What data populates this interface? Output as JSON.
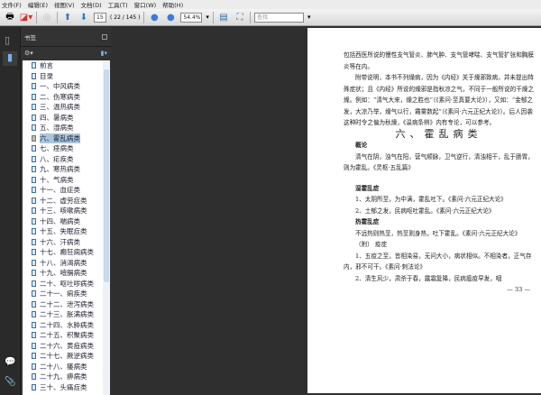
{
  "menu": [
    "文件(F)",
    "编辑(E)",
    "视图(V)",
    "文档(D)",
    "工具(T)",
    "窗口(W)",
    "帮助(H)"
  ],
  "toolbar": {
    "page_number": "15",
    "page_count": "( 22 / 145 )",
    "zoom": "54.4%",
    "search_placeholder": "查找"
  },
  "panel": {
    "title": "书签"
  },
  "bookmarks": [
    "前言",
    "目录",
    "一、中风病类",
    "二、伤寒病类",
    "三、温热病类",
    "四、暑病类",
    "五、湿病类",
    "六、霍乱病类",
    "七、痉病类",
    "八、疟疾类",
    "九、寒热病类",
    "十、气病类",
    "十一、血症类",
    "十二、虚劳症类",
    "十三、咳嗽病类",
    "十四、喘病类",
    "十五、失眠症类",
    "十六、汗病类",
    "十七、癫狂痫病类",
    "十八、消渴病类",
    "十九、噎膈病类",
    "二十、呕吐哕病类",
    "二十一、痢疾类",
    "二十二、泄泻病类",
    "二十三、胀满病类",
    "二十四、水肿病类",
    "二十五、积聚病类",
    "二十六、黄疸病类",
    "二十七、厥逆病类",
    "二十八、痿病类",
    "二十九、痹病类",
    "三十、头痛症类"
  ],
  "selected_bookmark": 7,
  "doc": {
    "p1": "包括西医所说的慢性支气管炎、肺气肿、支气管哮喘、支气管扩张和胸膜炎等在内。",
    "p2": "附带说明，本书不列燥病，因为《内经》关于燥邪致病，并未提出特殊症状；且《内经》所说的燥邪是指秋凉之气，不同于一般所说的干燥之燥。例如：“清气大来，燥之胜也”（《素问·至真要大论》），又如：“金郁之发，大凉乃举，燥气以行，霿雾数起”（《素问·六元正纪大论》）。后人因袭这种时令之偏为秋燥，《温病条辨》内有专论，可以参考。",
    "title": "六、霍乱病类",
    "h_overview": "概论",
    "p3": "清气在阴，浊气在阳，营气顺脉，卫气逆行，清浊相干，乱于肠胃，则为霍乱。《灵枢·五乱篇》",
    "h_cold": "湿霍乱症",
    "p4": "1、太阴所至，为中满，霍乱吐下。《素问·六元正纪大论》",
    "p5": "2、土郁之发，民病呕吐霍乱。《素问·六元正纪大论》",
    "h_hot": "热霍乱症",
    "p6": "不远热则热至，热至则身热，吐下霍乱。《素问·六元正纪大论》",
    "h_appendix": "（附） 疫症",
    "p7": "1、五疫之至，皆相染易，无问大小，病状相似。不相染者，正气存内，邪不可干。《素问·刺法论》",
    "p8": "2、清生风少，肃杀于春，露霜复降，民病瘟疫早发，咽",
    "page_no": "— 33 —"
  }
}
